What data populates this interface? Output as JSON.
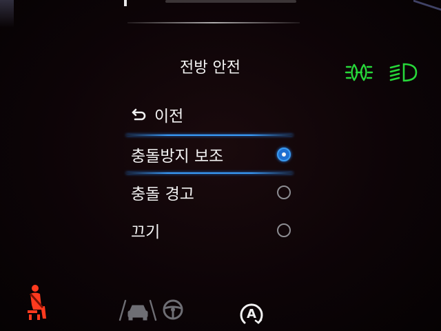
{
  "menu": {
    "title": "전방 안전",
    "back_label": "이전",
    "options": [
      {
        "label": "충돌방지 보조",
        "selected": true
      },
      {
        "label": "충돌 경고",
        "selected": false
      },
      {
        "label": "끄기",
        "selected": false
      }
    ]
  },
  "indicators": {
    "fog_light_icon": "front-fog-light-icon",
    "low_beam_icon": "low-beam-headlight-icon",
    "indicator_color": "#27d83a",
    "seatbelt_icon": "seatbelt-warning-icon",
    "seatbelt_color": "#ff3a1e",
    "lane_icon": "lane-assist-icon",
    "steering_icon": "steering-wheel-icon",
    "auto_hold_label": "A"
  },
  "colors": {
    "accent": "#3aa0ff",
    "background": "#0d0407"
  }
}
